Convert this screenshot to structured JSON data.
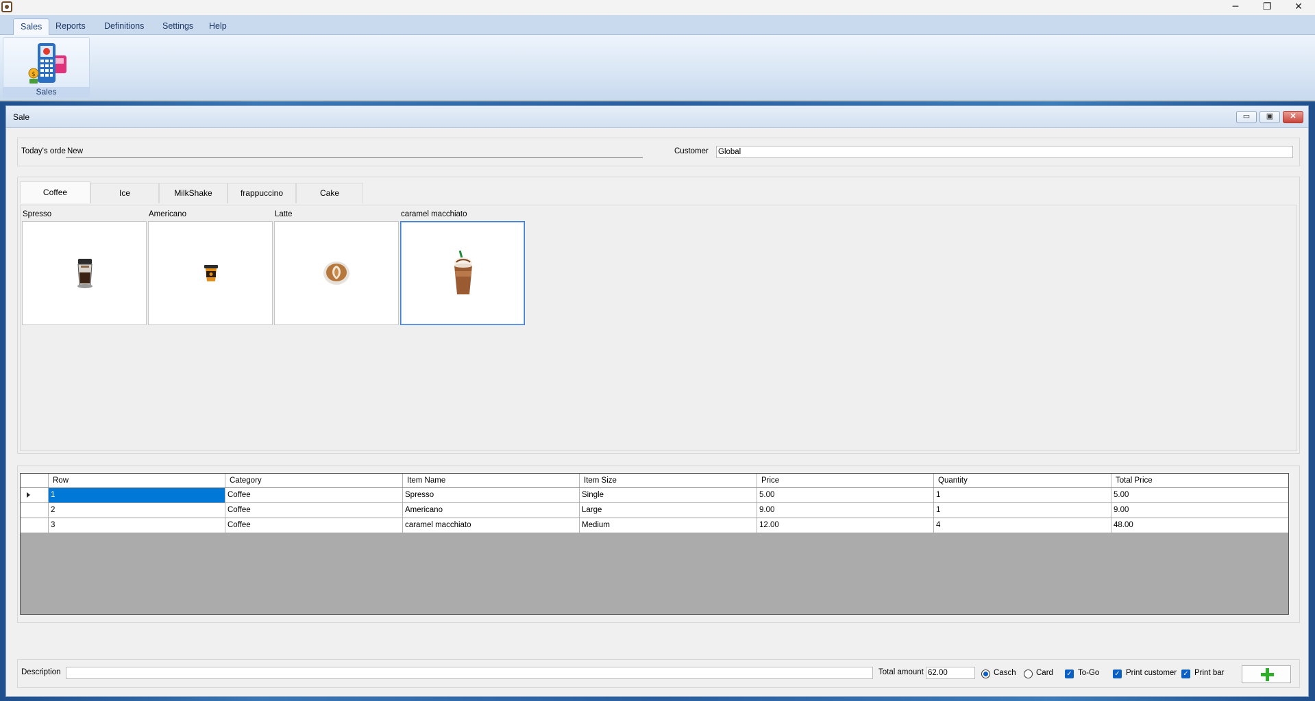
{
  "window": {
    "minimize_glyph": "─",
    "restore_glyph": "❐",
    "close_glyph": "✕"
  },
  "menu": {
    "items": [
      "Sales",
      "Reports",
      "Definitions",
      "Settings",
      "Help"
    ],
    "active": "Sales"
  },
  "ribbon": {
    "sales_button_label": "Sales",
    "icon": "pos-terminal-icon"
  },
  "sale_window": {
    "title": "Sale",
    "mdi_minimize": "▭",
    "mdi_restore": "▣",
    "mdi_close": "✕"
  },
  "header": {
    "todays_orders_label": "Today's orders",
    "todays_orders_value": "New",
    "customer_label": "Customer",
    "customer_value": "Global"
  },
  "tabs": [
    "Coffee",
    "Ice",
    "MilkShake",
    "frappuccino",
    "Cake"
  ],
  "active_tab": "Coffee",
  "products": [
    {
      "name": "Spresso",
      "icon": "espresso-cup-icon"
    },
    {
      "name": "Americano",
      "icon": "takeaway-cup-icon"
    },
    {
      "name": "Latte",
      "icon": "latte-art-cup-icon"
    },
    {
      "name": "caramel macchiato",
      "icon": "iced-drink-icon",
      "selected": true
    }
  ],
  "grid": {
    "columns": [
      "Row",
      "Category",
      "Item Name",
      "Item Size",
      "Price",
      "Quantity",
      "Total Price"
    ],
    "rows": [
      [
        "1",
        "Coffee",
        "Spresso",
        "Single",
        "5.00",
        "1",
        "5.00"
      ],
      [
        "2",
        "Coffee",
        "Americano",
        "Large",
        "9.00",
        "1",
        "9.00"
      ],
      [
        "3",
        "Coffee",
        "caramel macchiato",
        "Medium",
        "12.00",
        "4",
        "48.00"
      ]
    ]
  },
  "footer": {
    "description_label": "Description",
    "description_value": "",
    "total_label": "Total amount",
    "total_value": "62.00",
    "payment_cash": "Casch",
    "payment_card": "Card",
    "payment_selected": "Casch",
    "togo_label": "To-Go",
    "print_customer_label": "Print customer",
    "print_bar_label": "Print bar",
    "check_glyph": "✓"
  },
  "colors": {
    "selection": "#0078d7",
    "accent_green": "#2fae2a",
    "ribbon_blue": "#c9d9ee"
  }
}
